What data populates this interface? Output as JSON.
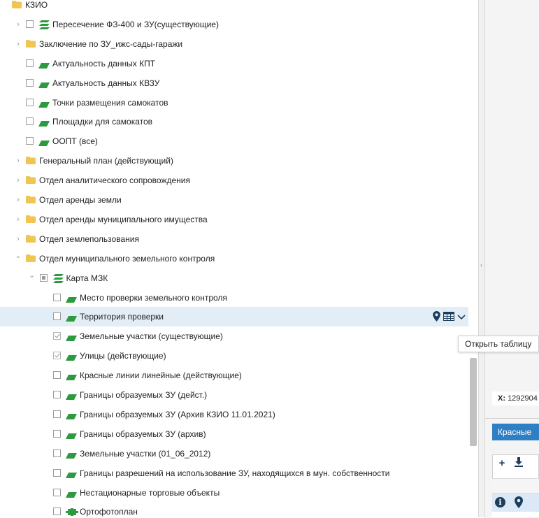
{
  "tree": {
    "rows": [
      {
        "label": "КЗИО",
        "kind": "folder",
        "expand": "none"
      },
      {
        "label": "Пересечение ФЗ-400 и ЗУ(существующие)",
        "kind": "group-layer",
        "expand": "collapsed",
        "checkbox": "unchecked"
      },
      {
        "label": "Заключение по ЗУ_ижс-сады-гаражи",
        "kind": "folder",
        "expand": "collapsed"
      },
      {
        "label": "Актуальность данных КПТ",
        "kind": "layer",
        "checkbox": "unchecked"
      },
      {
        "label": "Актуальность данных КВЗУ",
        "kind": "layer",
        "checkbox": "unchecked"
      },
      {
        "label": "Точки размещения самокатов",
        "kind": "layer",
        "checkbox": "unchecked"
      },
      {
        "label": "Площадки для самокатов",
        "kind": "layer",
        "checkbox": "unchecked"
      },
      {
        "label": "ООПТ (все)",
        "kind": "layer",
        "checkbox": "unchecked"
      },
      {
        "label": "Генеральный план (действующий)",
        "kind": "folder",
        "expand": "collapsed"
      },
      {
        "label": "Отдел аналитического сопровождения",
        "kind": "folder",
        "expand": "collapsed"
      },
      {
        "label": "Отдел аренды земли",
        "kind": "folder",
        "expand": "collapsed"
      },
      {
        "label": "Отдел аренды муниципального имущества",
        "kind": "folder",
        "expand": "collapsed"
      },
      {
        "label": "Отдел землепользования",
        "kind": "folder",
        "expand": "collapsed"
      },
      {
        "label": "Отдел муниципального земельного контроля",
        "kind": "folder",
        "expand": "expanded"
      },
      {
        "label": "Карта МЗК",
        "kind": "group-layer",
        "expand": "expanded",
        "checkbox": "partial"
      },
      {
        "label": "Место проверки земельного контроля",
        "kind": "layer",
        "checkbox": "unchecked"
      },
      {
        "label": "Территория проверки",
        "kind": "layer",
        "checkbox": "unchecked",
        "selected": true
      },
      {
        "label": "Земельные участки (существующие)",
        "kind": "layer",
        "checkbox": "checked"
      },
      {
        "label": "Улицы (действующие)",
        "kind": "layer",
        "checkbox": "checked"
      },
      {
        "label": "Красные линии линейные (действующие)",
        "kind": "layer",
        "checkbox": "unchecked"
      },
      {
        "label": "Границы образуемых ЗУ (дейст.)",
        "kind": "layer",
        "checkbox": "unchecked"
      },
      {
        "label": "Границы образуемых ЗУ (Архив КЗИО 11.01.2021)",
        "kind": "layer",
        "checkbox": "unchecked"
      },
      {
        "label": "Границы образуемых ЗУ (архив)",
        "kind": "layer",
        "checkbox": "unchecked"
      },
      {
        "label": "Земельные участки (01_06_2012)",
        "kind": "layer",
        "checkbox": "unchecked"
      },
      {
        "label": "Границы разрешений на использование ЗУ, находящихся в мун. собственности",
        "kind": "layer",
        "checkbox": "unchecked"
      },
      {
        "label": "Нестационарные торговые объекты",
        "kind": "layer",
        "checkbox": "unchecked"
      },
      {
        "label": "Ортофотоплан",
        "kind": "raster",
        "checkbox": "unchecked"
      }
    ]
  },
  "row_actions": {
    "pin_icon": "map-pin-icon",
    "table_icon": "table-icon",
    "menu_icon": "chevron-down-icon"
  },
  "tooltip": {
    "text": "Открыть таблицу"
  },
  "coords": {
    "x_label": "X:",
    "x_value": "1292904"
  },
  "bottom": {
    "tab_label": "Красные"
  },
  "colors": {
    "folder": "#f0c552",
    "layer": "#2e9a3f",
    "selected_row": "#e3edf6",
    "tab": "#2f7fc3",
    "icon_dark": "#1d3d5c"
  }
}
